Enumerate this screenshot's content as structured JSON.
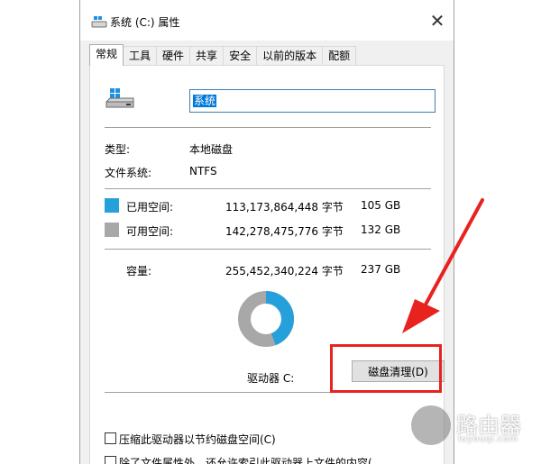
{
  "window": {
    "title": "系统 (C:) 属性",
    "close_icon": "close-icon"
  },
  "tabs": [
    {
      "label": "常规",
      "active": true
    },
    {
      "label": "工具",
      "active": false
    },
    {
      "label": "硬件",
      "active": false
    },
    {
      "label": "共享",
      "active": false
    },
    {
      "label": "安全",
      "active": false
    },
    {
      "label": "以前的版本",
      "active": false
    },
    {
      "label": "配额",
      "active": false
    }
  ],
  "general": {
    "drive_name": "系统",
    "type_label": "类型:",
    "type_value": "本地磁盘",
    "fs_label": "文件系统:",
    "fs_value": "NTFS",
    "used": {
      "label": "已用空间:",
      "bytes": "113,173,864,448 字节",
      "size": "105 GB",
      "color": "#26a0da"
    },
    "free": {
      "label": "可用空间:",
      "bytes": "142,278,475,776 字节",
      "size": "132 GB",
      "color": "#a8a8a8"
    },
    "capacity": {
      "label": "容量:",
      "bytes": "255,452,340,224 字节",
      "size": "237 GB"
    },
    "used_fraction": 0.443,
    "drive_letter_label": "驱动器 C:",
    "cleanup_button": "磁盘清理(D)",
    "compress_option": "压缩此驱动器以节约磁盘空间(C)",
    "index_option": "除了文件属性外，还允许索引此驱动器上文件的内容("
  },
  "annotation": {
    "color": "#e8221f"
  },
  "watermark": {
    "title": "路由器",
    "subtitle": "luyouqi.com"
  }
}
